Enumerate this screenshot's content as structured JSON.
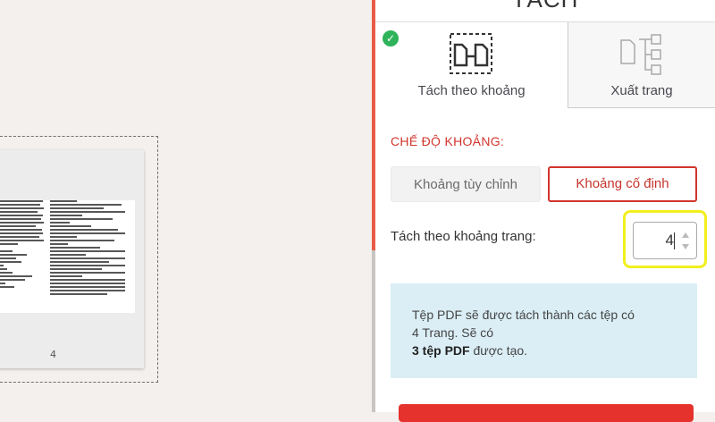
{
  "preview": {
    "page_number": "4"
  },
  "panel": {
    "title": "TÁCH",
    "tabs": [
      {
        "label": "Tách theo khoảng",
        "icon": "split-range-icon",
        "selected": true
      },
      {
        "label": "Xuất trang",
        "icon": "extract-pages-icon",
        "selected": false
      }
    ],
    "mode": {
      "title": "CHẾ ĐỘ KHOẢNG:",
      "options": [
        {
          "label": "Khoảng tùy chỉnh",
          "selected": false
        },
        {
          "label": "Khoảng cố định",
          "selected": true
        }
      ]
    },
    "split": {
      "label": "Tách theo khoảng trang:",
      "value": "4"
    },
    "info": {
      "line1": "Tệp PDF sẽ được tách thành các tệp có",
      "line2": "4 Trang. Sẽ có",
      "bold": "3 tệp PDF",
      "tail": " được tạo."
    }
  },
  "colors": {
    "accent": "#e5322d",
    "highlight": "#f2ef1d",
    "info_bg": "#dbeef6",
    "check": "#2fb35a"
  }
}
